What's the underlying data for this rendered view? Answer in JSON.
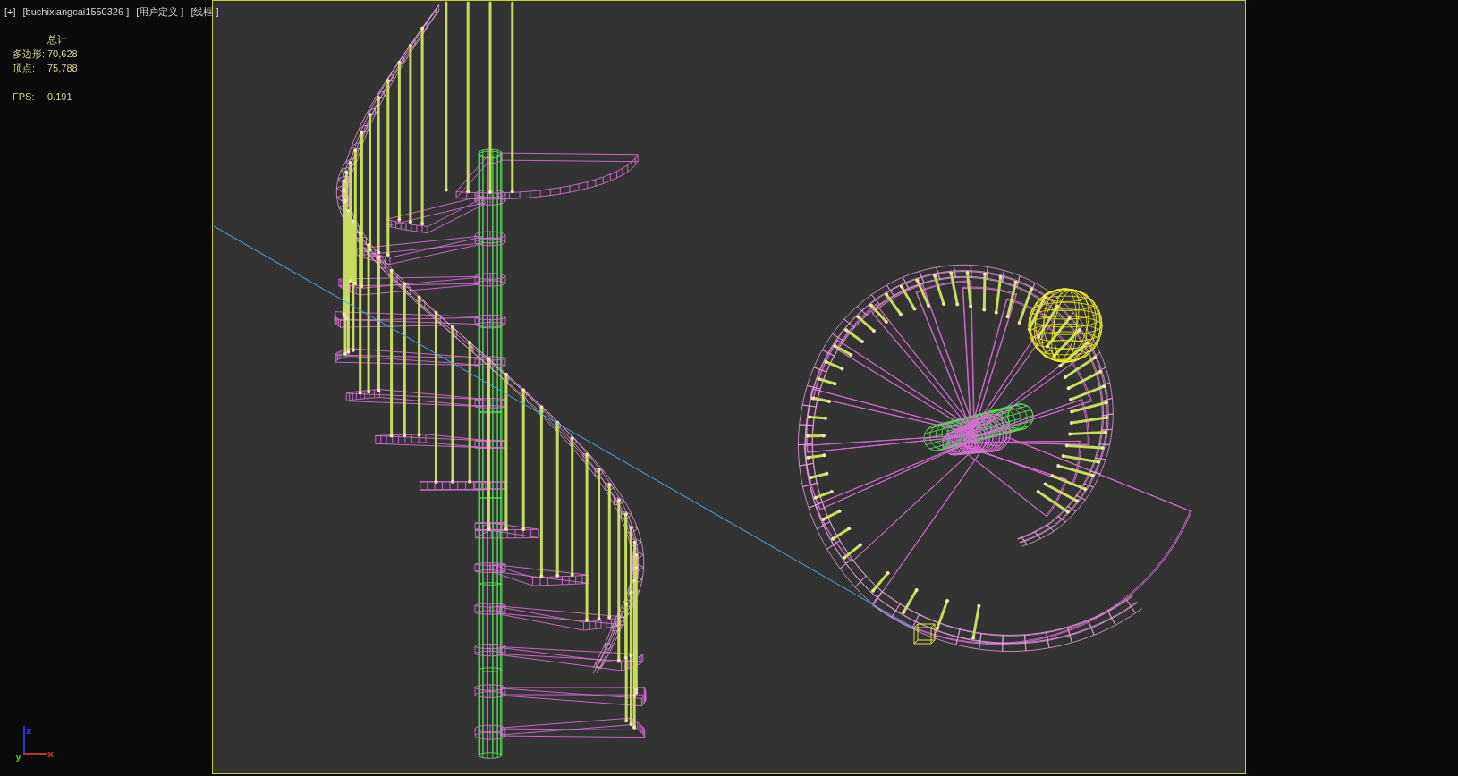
{
  "viewport_labels": [
    "[+]",
    "[buchixiangcai1550326 ]",
    "[用户定义 ]",
    "[线框 ]"
  ],
  "statistics": {
    "header": "总计",
    "rows": [
      {
        "label": "多边形:",
        "value": "70,628"
      },
      {
        "label": "顶点:",
        "value": "75,788"
      }
    ],
    "fps": {
      "label": "FPS:",
      "value": "0.191"
    }
  },
  "axis_tripod": [
    {
      "kind": "vertical",
      "label": "z",
      "color": "#3434c8"
    },
    {
      "kind": "horizontal",
      "label": "x",
      "color": "#c43030"
    },
    {
      "kind": "depth",
      "label": "y",
      "color": "#38b038"
    }
  ]
}
